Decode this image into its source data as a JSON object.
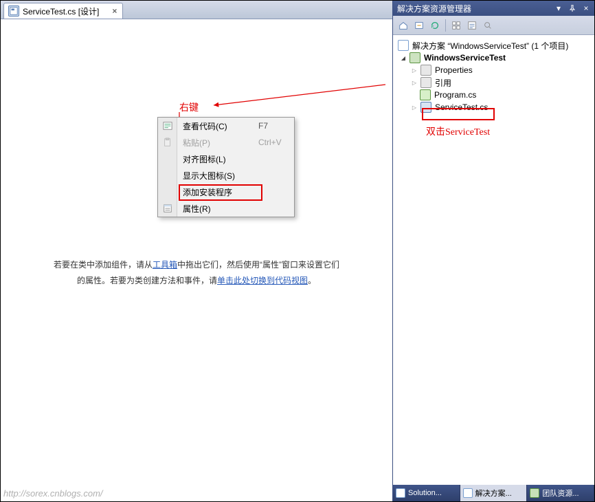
{
  "editor": {
    "tab": {
      "label": "ServiceTest.cs [设计]",
      "close": "×"
    },
    "guidance": {
      "line1_pre": "若要在类中添加组件，请从",
      "toolbox_link": "工具箱",
      "line1_post": "中拖出它们，然后使用“属性”窗口来设置它们",
      "line2_pre": "的属性。若要为类创建方法和事件，请",
      "codeview_link": "单击此处切换到代码视图",
      "line2_post": "。"
    },
    "watermark": "http://sorex.cnblogs.com/"
  },
  "context_menu": {
    "items": [
      {
        "label": "查看代码(C)",
        "shortcut": "F7",
        "icon": "code-icon",
        "disabled": false
      },
      {
        "label": "粘贴(P)",
        "shortcut": "Ctrl+V",
        "icon": "paste-icon",
        "disabled": true
      },
      {
        "label": "对齐图标(L)",
        "shortcut": "",
        "icon": "",
        "disabled": false
      },
      {
        "label": "显示大图标(S)",
        "shortcut": "",
        "icon": "",
        "disabled": false
      },
      {
        "label": "添加安装程序",
        "shortcut": "",
        "icon": "",
        "disabled": false
      },
      {
        "label": "属性(R)",
        "shortcut": "",
        "icon": "properties-icon",
        "disabled": false
      }
    ]
  },
  "annotations": {
    "right_click_label": "右键",
    "double_click_label": "双击ServiceTest"
  },
  "solution_explorer": {
    "title": "解决方案资源管理器",
    "toolbar_icons": [
      "home-icon",
      "back-icon",
      "refresh-icon",
      "show-all-icon",
      "properties-icon",
      "view-icon"
    ],
    "tree": {
      "solution": {
        "label": "解决方案 “WindowsServiceTest” (1 个项目)"
      },
      "project": {
        "label": "WindowsServiceTest"
      },
      "properties": {
        "label": "Properties"
      },
      "references": {
        "label": "引用"
      },
      "program": {
        "label": "Program.cs"
      },
      "servicetest": {
        "label": "ServiceTest.cs"
      }
    },
    "bottom_tabs": [
      {
        "label": "Solution..."
      },
      {
        "label": "解决方案..."
      },
      {
        "label": "团队资源..."
      }
    ]
  }
}
